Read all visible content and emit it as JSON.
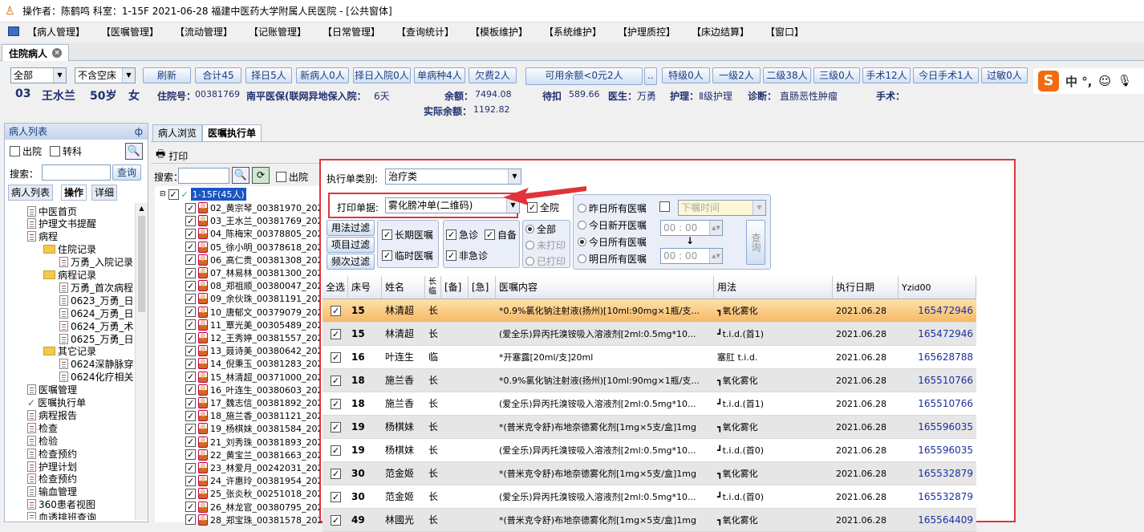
{
  "window": {
    "title": "操作者：陈鹤鸣  科室：1-15F  2021-06-28  福建中医药大学附属人民医院 - [公共窗体]"
  },
  "menu": [
    "【病人管理】",
    "【医嘱管理】",
    "【流动管理】",
    "【记账管理】",
    "【日常管理】",
    "【查询统计】",
    "【模板维护】",
    "【系统维护】",
    "【护理质控】",
    "【床边结算】",
    "【窗口】"
  ],
  "doc_tab": {
    "label": "住院病人"
  },
  "toolbar": {
    "filter1": "全部",
    "filter2": "不含空床",
    "buttons": [
      "刷新",
      "合计45",
      "择日5人",
      "新病人0人",
      "择日入院0人",
      "单病种4人",
      "欠费2人"
    ],
    "avail_btn": "可用余额<0元2人",
    "more_btn": "..",
    "buttons2": [
      "特级0人",
      "一级2人",
      "二级38人",
      "三级0人",
      "手术12人",
      "今日手术1人",
      "过敏0人"
    ]
  },
  "patient": {
    "bed": "03",
    "name": "王水兰",
    "age": "50岁",
    "sex": "女",
    "inpatient_no_label": "住院号：",
    "inpatient_no": "00381769",
    "insurance": "南平医保(联网异地保入院：",
    "days": "6天",
    "balance_label": "余额：",
    "balance": "7494.08",
    "pending_label": "待扣",
    "pending": "589.66",
    "doctor_label": "医生：",
    "doctor": "万勇",
    "nursing_label": "护理：",
    "nursing": "Ⅱ级护理",
    "diagnosis_label": "诊断：",
    "diagnosis": "直肠恶性肿瘤",
    "surgery_label": "手术：",
    "actual_label": "实际余额：",
    "actual": "1192.82"
  },
  "ime": {
    "label": "中 °,"
  },
  "left": {
    "header": "病人列表",
    "pin": "ф",
    "cb1": "出院",
    "cb2": "转科",
    "search_label": "搜索：",
    "query_btn": "查询",
    "tabs": [
      "病人列表",
      "操作",
      "详细"
    ],
    "tree": [
      {
        "t": "中医首页",
        "lv": 1,
        "k": "doc"
      },
      {
        "t": "护理文书提醒",
        "lv": 1,
        "k": "doc"
      },
      {
        "t": "病程",
        "lv": 1,
        "k": "doc"
      },
      {
        "t": "住院记录",
        "lv": 2,
        "k": "folder"
      },
      {
        "t": "万勇_入院记录",
        "lv": 3,
        "k": "doc"
      },
      {
        "t": "病程记录",
        "lv": 2,
        "k": "folder"
      },
      {
        "t": "万勇_首次病程",
        "lv": 3,
        "k": "doc"
      },
      {
        "t": "0623_万勇_日",
        "lv": 3,
        "k": "doc"
      },
      {
        "t": "0624_万勇_日",
        "lv": 3,
        "k": "doc"
      },
      {
        "t": "0624_万勇_术",
        "lv": 3,
        "k": "doc"
      },
      {
        "t": "0625_万勇_日",
        "lv": 3,
        "k": "doc"
      },
      {
        "t": "其它记录",
        "lv": 2,
        "k": "folder"
      },
      {
        "t": "0624深静脉穿",
        "lv": 3,
        "k": "doc"
      },
      {
        "t": "0624化疗相关",
        "lv": 3,
        "k": "doc"
      },
      {
        "t": "医嘱管理",
        "lv": 1,
        "k": "doc"
      },
      {
        "t": "医嘱执行单",
        "lv": 1,
        "k": "check"
      },
      {
        "t": "病程报告",
        "lv": 1,
        "k": "doc"
      },
      {
        "t": "检查",
        "lv": 1,
        "k": "doc"
      },
      {
        "t": "检验",
        "lv": 1,
        "k": "doc"
      },
      {
        "t": "检查预约",
        "lv": 1,
        "k": "doc"
      },
      {
        "t": "护理计划",
        "lv": 1,
        "k": "doc"
      },
      {
        "t": "检查预约",
        "lv": 1,
        "k": "doc"
      },
      {
        "t": "输血管理",
        "lv": 1,
        "k": "doc"
      },
      {
        "t": "360患者视图",
        "lv": 1,
        "k": "doc"
      },
      {
        "t": "血透排班查询",
        "lv": 1,
        "k": "doc"
      }
    ]
  },
  "mid": {
    "tabs": [
      "病人浏览",
      "医嘱执行单"
    ],
    "print": "打印",
    "search_label": "搜索：",
    "discharge": "出院",
    "root": "1-15F(45人)",
    "patients": [
      "02_黄宗琴_00381970_202",
      "03_王水兰_00381769_202",
      "04_陈梅宋_00378805_202",
      "05_徐小明_00378618_202",
      "06_高仁贵_00381308_202",
      "07_林易林_00381300_202",
      "08_郑祖顺_00380047_202",
      "09_余伙珠_00381191_202",
      "10_唐郁文_00379079_202",
      "11_覃光美_00305489_202",
      "12_王秀婷_00381557_202",
      "13_聂诗美_00380642_202",
      "14_倪秉玉_00381283_202",
      "15_林清超_00371000_202",
      "16_叶连生_00380603_202",
      "17_魏志信_00381892_202",
      "18_施兰香_00381121_202",
      "19_杨棋妹_00381584_202",
      "21_刘秀珠_00381893_202",
      "22_黄宝兰_00381663_202",
      "23_林爱月_00242031_202",
      "24_许惠玲_00381954_202",
      "25_张炎秋_00251018_202",
      "26_林龙官_00380795_202",
      "28_郑宝珠_00381578_202"
    ]
  },
  "dialog": {
    "type_label": "执行单类别:",
    "type_value": "治疗类",
    "print_label": "打印单据:",
    "print_value": "雾化膀冲单(二维码)",
    "all_ward": "全院",
    "yesterday": "昨日所有医嘱",
    "today_new": "今日新开医嘱",
    "today_all": "今日所有医嘱",
    "tomorrow": "明日所有医嘱",
    "order_time": "下嘱时间",
    "time1": "00 : 00",
    "time2": "00 : 00",
    "arrow": "↓",
    "query": "查询",
    "filter_btns": [
      "用法过滤",
      "项目过滤",
      "频次过滤"
    ],
    "long": "长期医嘱",
    "temp": "临时医嘱",
    "urgent": "急诊",
    "self": "自备",
    "nonurgent": "非急诊",
    "print_all": "全部",
    "unprinted": "未打印",
    "printed": "已打印",
    "headers": [
      "全选",
      "床号",
      "姓名",
      "长临",
      "[备]",
      "[急]",
      "医嘱内容",
      "用法",
      "执行日期",
      "Yzid00"
    ],
    "rows": [
      {
        "bed": "15",
        "name": "林清超",
        "kind": "长",
        "content": "*0.9%氯化钠注射液(扬州)[10ml:90mg×1瓶/支...",
        "usage": "┓氧化雾化",
        "date": "2021.06.28",
        "id": "165472946"
      },
      {
        "bed": "15",
        "name": "林清超",
        "kind": "长",
        "content": "(爱全乐)异丙托溴铵吸入溶液剂[2ml:0.5mg*10...",
        "usage": "┛t.i.d.(首1)",
        "date": "2021.06.28",
        "id": "165472946"
      },
      {
        "bed": "16",
        "name": "叶连生",
        "kind": "临",
        "content": "*开塞露[20ml/支]20ml",
        "usage": "塞肛 t.i.d.",
        "date": "2021.06.28",
        "id": "165628788"
      },
      {
        "bed": "18",
        "name": "施兰香",
        "kind": "长",
        "content": "*0.9%氯化钠注射液(扬州)[10ml:90mg×1瓶/支...",
        "usage": "┓氧化雾化",
        "date": "2021.06.28",
        "id": "165510766"
      },
      {
        "bed": "18",
        "name": "施兰香",
        "kind": "长",
        "content": "(爱全乐)异丙托溴铵吸入溶液剂[2ml:0.5mg*10...",
        "usage": "┛t.i.d.(首1)",
        "date": "2021.06.28",
        "id": "165510766"
      },
      {
        "bed": "19",
        "name": "杨棋妹",
        "kind": "长",
        "content": "*(普米克令舒)布地奈德雾化剂[1mg×5支/盒]1mg",
        "usage": "┓氧化雾化",
        "date": "2021.06.28",
        "id": "165596035"
      },
      {
        "bed": "19",
        "name": "杨棋妹",
        "kind": "长",
        "content": "(爱全乐)异丙托溴铵吸入溶液剂[2ml:0.5mg*10...",
        "usage": "┛t.i.d.(首0)",
        "date": "2021.06.28",
        "id": "165596035"
      },
      {
        "bed": "30",
        "name": "范金姬",
        "kind": "长",
        "content": "*(普米克令舒)布地奈德雾化剂[1mg×5支/盒]1mg",
        "usage": "┓氧化雾化",
        "date": "2021.06.28",
        "id": "165532879"
      },
      {
        "bed": "30",
        "name": "范金姬",
        "kind": "长",
        "content": "(爱全乐)异丙托溴铵吸入溶液剂[2ml:0.5mg*10...",
        "usage": "┛t.i.d.(首0)",
        "date": "2021.06.28",
        "id": "165532879"
      },
      {
        "bed": "49",
        "name": "林國光",
        "kind": "长",
        "content": "*(普米克令舒)布地奈德雾化剂[1mg×5支/盒]1mg",
        "usage": "┓氧化雾化",
        "date": "2021.06.28",
        "id": "165564409"
      }
    ]
  }
}
